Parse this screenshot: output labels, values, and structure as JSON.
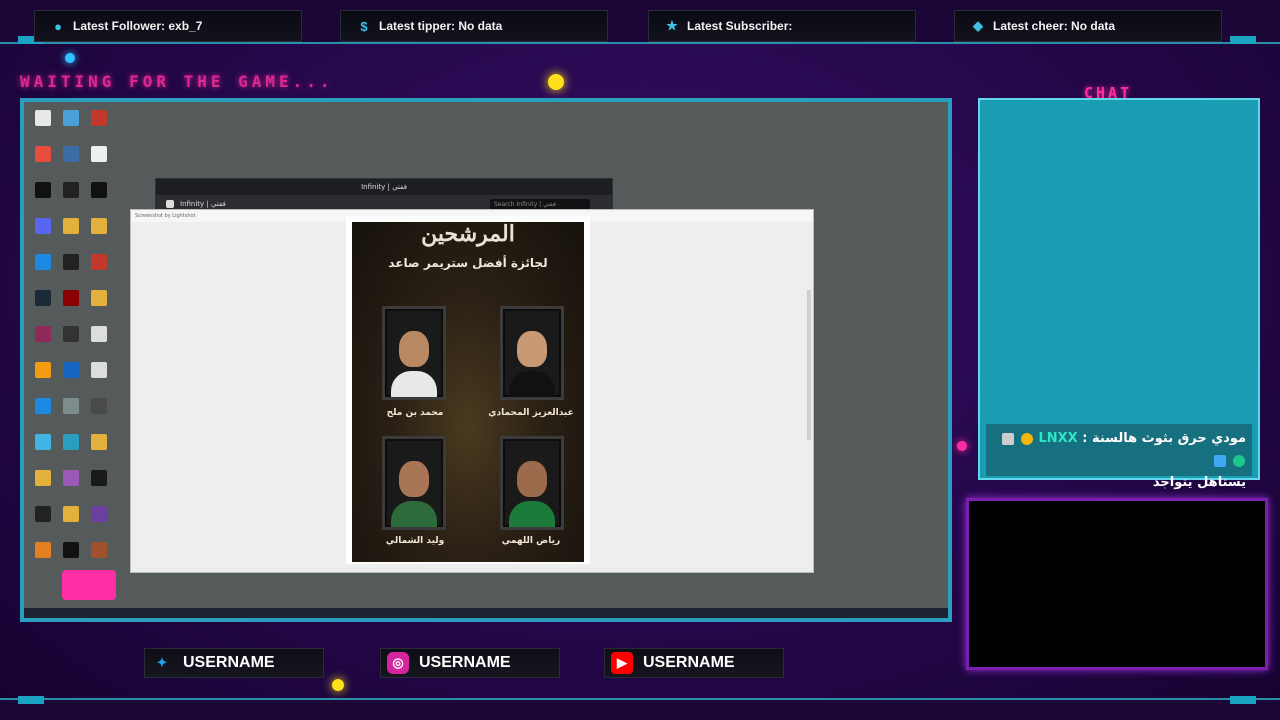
{
  "tickers": [
    {
      "icon": "user-icon",
      "glyph": "●",
      "text": "Latest Follower: exb_7"
    },
    {
      "icon": "dollar-icon",
      "glyph": "$",
      "text": "Latest tipper: No data"
    },
    {
      "icon": "star-icon",
      "glyph": "★",
      "text": "Latest Subscriber:"
    },
    {
      "icon": "diamond-icon",
      "glyph": "◆",
      "text": "Latest cheer: No data"
    }
  ],
  "status": {
    "waiting": "WAITING FOR THE GAME..."
  },
  "discord": {
    "title": "Infinity | ففتي",
    "server": "Infinity | ففتي",
    "search_placeholder": "Search Infinity | ففتي"
  },
  "viewer": {
    "title": "Screenshot by Lightshot"
  },
  "poster": {
    "headline": "المرشحين",
    "subtitle": "لجائزة أفضل ستريمر صاعد",
    "nominees": [
      {
        "name": "محمد بن ملح"
      },
      {
        "name": "عبدالعزيز المحمادي"
      },
      {
        "name": "وليد الشمالي"
      },
      {
        "name": "رياض اللهمي"
      }
    ]
  },
  "chat": {
    "title": "CHAT",
    "message": {
      "user": "LNXX",
      "text": "مودي حرق بثوث هالسنة :",
      "text2": "يستاهل يتواجد"
    }
  },
  "socials": [
    {
      "icon": "twitter-icon",
      "label": "USERNAME",
      "color": "#1da1f2"
    },
    {
      "icon": "instagram-icon",
      "label": "USERNAME",
      "color": "#d6249f"
    },
    {
      "icon": "youtube-icon",
      "label": "USERNAME",
      "color": "#ff0000"
    }
  ]
}
